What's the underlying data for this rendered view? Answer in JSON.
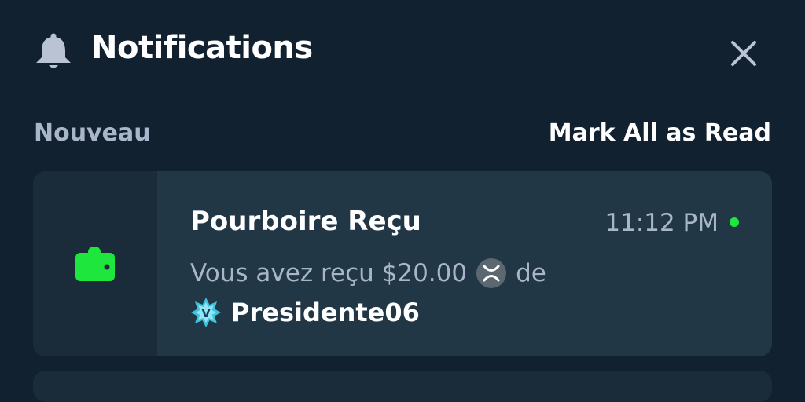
{
  "header": {
    "title": "Notifications",
    "bell_icon": "bell-icon",
    "close_icon": "close-icon"
  },
  "section": {
    "label": "Nouveau",
    "mark_all_label": "Mark All as Read"
  },
  "notifications": [
    {
      "icon": "wallet-icon",
      "title": "Pourboire Reçu",
      "time": "11:12 PM",
      "unread": true,
      "message_prefix": "Vous avez reçu $20.00",
      "currency_icon": "xrp-coin-icon",
      "message_suffix": "de",
      "badge_icon": "vip-star-badge-icon",
      "badge_letter": "V",
      "username": "Presidente06"
    }
  ],
  "colors": {
    "background": "#112130",
    "card": "#213745",
    "card_icon_panel": "#1a2c39",
    "muted_text": "#a9b6c9",
    "accent_green": "#1ee63c",
    "unread_dot": "#1ee63c"
  }
}
